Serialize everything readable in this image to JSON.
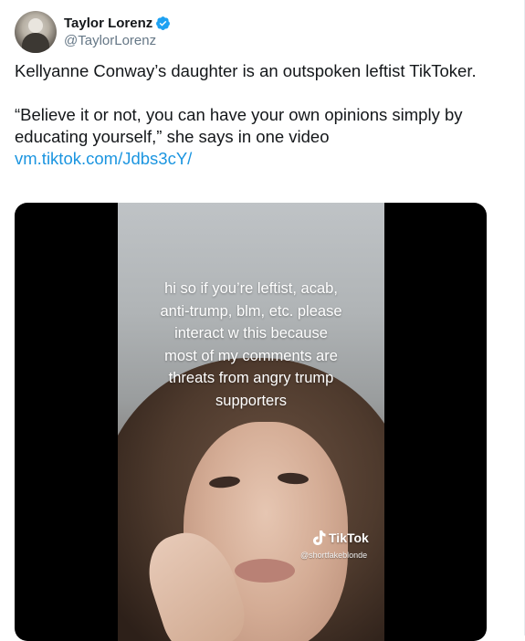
{
  "author": {
    "display_name": "Taylor Lorenz",
    "handle": "@TaylorLorenz",
    "verified": true,
    "avatar_icon": "user-avatar-photo"
  },
  "tweet": {
    "line1": "Kellyanne Conway’s daughter is an outspoken leftist TikToker.",
    "line2": "“Believe it or not, you can have your own opinions simply by educating yourself,” she says in one video",
    "link_text": "vm.tiktok.com/Jdbs3cY/"
  },
  "media": {
    "caption_lines": [
      "hi so if you’re leftist, acab,",
      "anti-trump, blm, etc. please",
      "interact w this because",
      "most of my comments are",
      "threats from angry trump",
      "supporters"
    ],
    "watermark_label": "TikTok",
    "watermark_user": "@shortfakeblonde"
  },
  "colors": {
    "link": "#1b95e0",
    "verified": "#1da1f2",
    "text": "#14171a",
    "secondary": "#657786"
  }
}
